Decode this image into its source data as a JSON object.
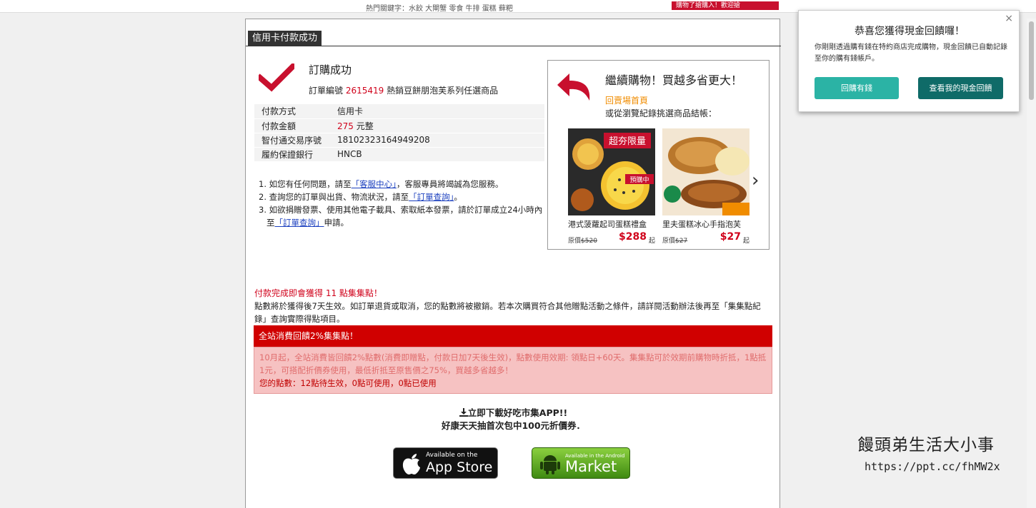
{
  "top": {
    "hot_keywords": "熱門關鍵字：水餃 大閘蟹 零食 牛排 蛋糕 藓粑",
    "ad_text": "購物了搶購入！歡迎搶"
  },
  "section": {
    "title": "信用卡付款成功"
  },
  "order": {
    "title": "訂購成功",
    "number_prefix": "訂單編號",
    "number": "2615419",
    "product": "熱銷豆餅朋泡芙系列任選商品"
  },
  "payment": {
    "rows": [
      {
        "label": "付款方式",
        "value": "信用卡",
        "red": "",
        "unit": ""
      },
      {
        "label": "付款金額",
        "value": "",
        "red": "275",
        "unit": " 元整"
      },
      {
        "label": "智付通交易序號",
        "value": "18102323164949208",
        "red": "",
        "unit": ""
      },
      {
        "label": "履約保證銀行",
        "value": "HNCB",
        "red": "",
        "unit": ""
      }
    ]
  },
  "notes": {
    "n1_a": "1. 如您有任何問題，請至",
    "n1_link": "「客服中心」",
    "n1_b": "，客服專員將竭誠為您服務。",
    "n2_a": "2. 查詢您的訂單與出貨、物流狀況，請至",
    "n2_link": "「訂單查詢」",
    "n2_b": "。",
    "n3_a": "3. 如欲捐贈發票、使用其他電子載具、索取紙本發票，請於訂單成立24小時內至",
    "n3_link": "「訂單查詢」",
    "n3_b": "申請。"
  },
  "promo": {
    "title": "繼續購物！買越多省更大！",
    "home_link": "回賣場首頁",
    "sub": "或從瀏覽紀錄挑選商品結帳：",
    "products": [
      {
        "name": "港式菠蘿起司蛋糕禮盒",
        "orig_label": "原價",
        "orig": "$520",
        "price": "$288",
        "unit": "起",
        "tag": "超夯限量",
        "badge": "預購中"
      },
      {
        "name": "里夫蛋糕冰心手指泡芙",
        "orig_label": "原價",
        "orig": "$27",
        "price": "$27",
        "unit": "起",
        "tag": "",
        "badge": ""
      }
    ],
    "next_symbol": "›"
  },
  "points": {
    "title": "付款完成即會獲得 11 點集集點！",
    "desc": "點數將於獲得後7天生效。如訂單退貨或取消，您的點數將被撤銷。若本次購買符合其他贈點活動之條件，請詳閱活動辦法後再至「集集點紀錄」查詢實際得點項目。",
    "bar": "全站消費回饋2%集集點！",
    "detail": "10月起，全站消費皆回饋2%點數(消費即贈點，付款日加7天後生效)，點數使用效期: 領點日+60天。集集點可於效期前購物時折抵，1點抵1元，可搭配折價券使用，最低折抵至原售價之75%，買越多省越多！",
    "mine": "您的點數：12點待生效，0點可使用，0點已使用"
  },
  "app": {
    "line1": "立即下載好吃市集APP!!",
    "line2": "好康天天抽首次包中100元折價券．",
    "appstore_small": "Available on the",
    "appstore_big": "App Store",
    "market_small": "Available in the Android",
    "market_big": "Market"
  },
  "popup": {
    "title": "恭喜您獲得現金回饋囉！",
    "message": "你剛剛透過購有錢在特約商店完成購物，現金回饋已自動記錄至你的購有錢帳戶。",
    "btn1": "回購有錢",
    "btn2": "查看我的現金回饋",
    "close": "×"
  },
  "watermark": {
    "line1": "饅頭弟生活大小事",
    "line2": "https://ppt.cc/fhMW2x"
  },
  "colors": {
    "accent_red": "#d0021b",
    "teal": "#2bb3a5",
    "dark_teal": "#0f6b68",
    "promo_orange": "#f08c00"
  }
}
